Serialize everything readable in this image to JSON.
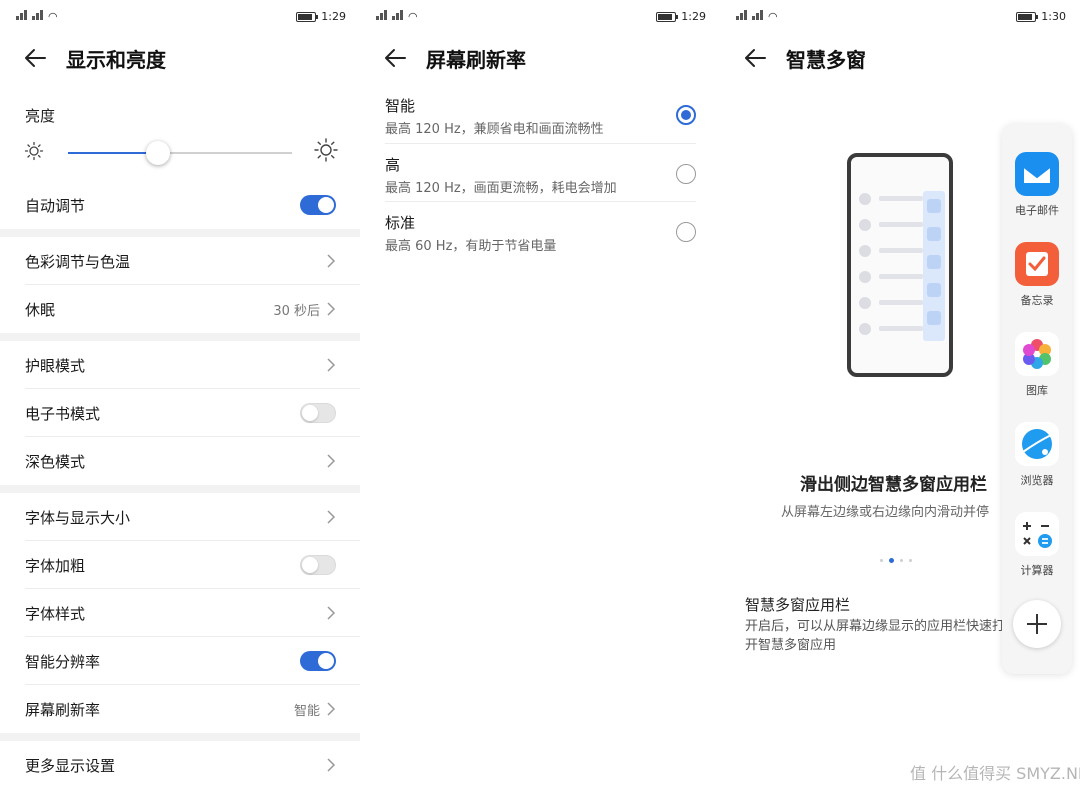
{
  "colors": {
    "accent": "#2e6bd6",
    "divider": "#ececec",
    "group_gap": "#f2f2f2"
  },
  "panel1": {
    "status": {
      "time": "1:29"
    },
    "title": "显示和亮度",
    "brightness_label": "亮度",
    "brightness_level": 0.4,
    "rows": {
      "auto_adjust": {
        "label": "自动调节",
        "toggle": "on"
      },
      "color_temp": {
        "label": "色彩调节与色温"
      },
      "sleep": {
        "label": "休眠",
        "value": "30 秒后"
      },
      "eye_comfort": {
        "label": "护眼模式"
      },
      "ebook_mode": {
        "label": "电子书模式",
        "toggle": "off"
      },
      "dark_mode": {
        "label": "深色模式"
      },
      "font_size": {
        "label": "字体与显示大小"
      },
      "bold_font": {
        "label": "字体加粗",
        "toggle": "off"
      },
      "font_style": {
        "label": "字体样式"
      },
      "smart_resolution": {
        "label": "智能分辨率",
        "toggle": "on"
      },
      "refresh_rate": {
        "label": "屏幕刷新率",
        "value": "智能"
      },
      "more_display": {
        "label": "更多显示设置"
      }
    }
  },
  "panel2": {
    "status": {
      "time": "1:29"
    },
    "title": "屏幕刷新率",
    "options": [
      {
        "name": "智能",
        "desc": "最高 120 Hz，兼顾省电和画面流畅性",
        "selected": true
      },
      {
        "name": "高",
        "desc": "最高 120 Hz，画面更流畅，耗电会增加",
        "selected": false
      },
      {
        "name": "标准",
        "desc": "最高 60 Hz，有助于节省电量",
        "selected": false
      }
    ]
  },
  "panel3": {
    "status": {
      "time": "1:30"
    },
    "title": "智慧多窗",
    "guide_title": "滑出侧边智慧多窗应用栏",
    "guide_sub": "从屏幕左边缘或右边缘向内滑动并停",
    "page_indicator": {
      "count": 4,
      "active": 1
    },
    "section_title": "智慧多窗应用栏",
    "section_desc": "开启后，可以从屏幕边缘显示的应用栏快速打开智慧多窗应用",
    "dock_apps": [
      {
        "name": "电子邮件",
        "icon": "email-icon"
      },
      {
        "name": "备忘录",
        "icon": "memo-icon"
      },
      {
        "name": "图库",
        "icon": "gallery-icon"
      },
      {
        "name": "浏览器",
        "icon": "browser-icon"
      },
      {
        "name": "计算器",
        "icon": "calculator-icon"
      }
    ],
    "add_button_icon": "plus-icon"
  },
  "watermark": "值 什么值得买 SMYZ.NET"
}
